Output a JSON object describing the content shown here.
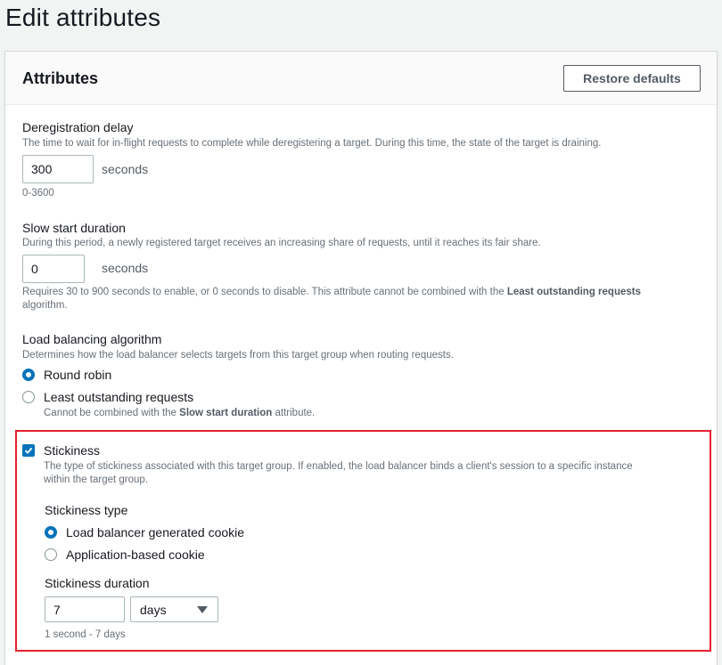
{
  "page_title": "Edit attributes",
  "panel": {
    "title": "Attributes",
    "restore_button": "Restore defaults"
  },
  "deregistration": {
    "label": "Deregistration delay",
    "description": "The time to wait for in-flight requests to complete while deregistering a target. During this time, the state of the target is draining.",
    "value": "300",
    "unit": "seconds",
    "range": "0-3600"
  },
  "slow_start": {
    "label": "Slow start duration",
    "description": "During this period, a newly registered target receives an increasing share of requests, until it reaches its fair share.",
    "value": "0",
    "unit": "seconds",
    "hint_before": "Requires 30 to 900 seconds to enable, or 0 seconds to disable. This attribute cannot be combined with the ",
    "hint_bold": "Least outstanding requests",
    "hint_after": "algorithm."
  },
  "algorithm": {
    "label": "Load balancing algorithm",
    "description": "Determines how the load balancer selects targets from this target group when routing requests.",
    "options": [
      {
        "label": "Round robin",
        "checked": true
      },
      {
        "label": "Least outstanding requests",
        "checked": false,
        "note_before": "Cannot be combined with the ",
        "note_bold": "Slow start duration",
        "note_after": " attribute."
      }
    ]
  },
  "stickiness": {
    "label": "Stickiness",
    "enabled": true,
    "description_line1": "The type of stickiness associated with this target group. If enabled, the load balancer binds a client's session to a specific instance",
    "description_line2": "within the target group.",
    "type_label": "Stickiness type",
    "type_options": [
      {
        "label": "Load balancer generated cookie",
        "checked": true
      },
      {
        "label": "Application-based cookie",
        "checked": false
      }
    ],
    "duration_label": "Stickiness duration",
    "duration_value": "7",
    "duration_unit": "days",
    "duration_range": "1 second - 7 days"
  },
  "colors": {
    "accent": "#0073bb",
    "highlight": "#e5202e"
  }
}
